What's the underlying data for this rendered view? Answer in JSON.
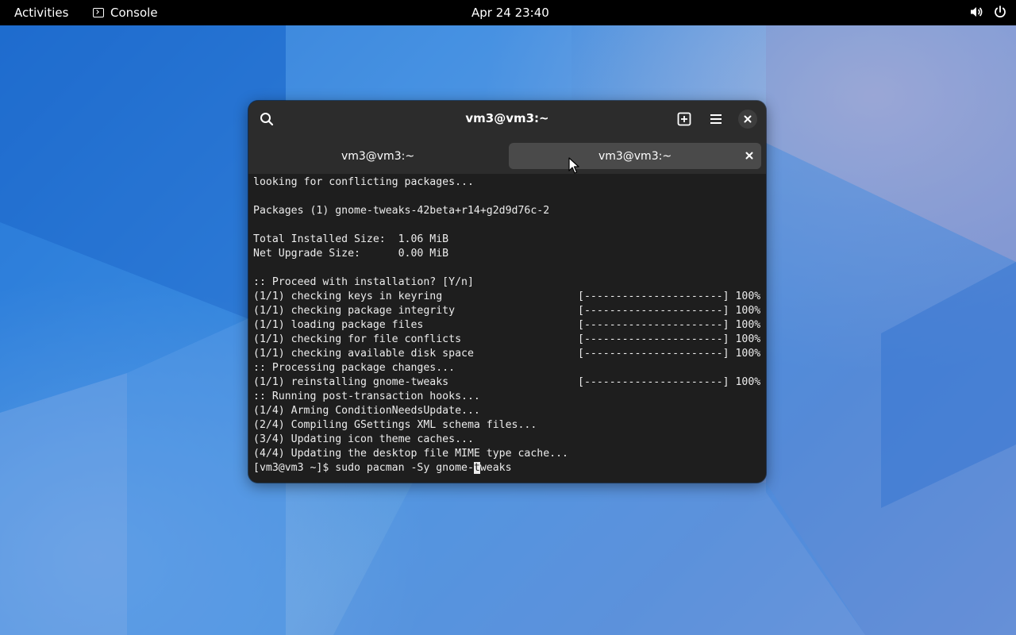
{
  "topbar": {
    "activities": "Activities",
    "app_name": "Console",
    "clock": "Apr 24  23:40",
    "icons": [
      "speaker-icon",
      "power-icon"
    ]
  },
  "window": {
    "title": "vm3@vm3:~",
    "icons": [
      "search-icon",
      "new-tab-icon",
      "menu-icon",
      "close-icon"
    ],
    "tabs": [
      {
        "label": "vm3@vm3:~",
        "active": false
      },
      {
        "label": "vm3@vm3:~",
        "active": true
      }
    ]
  },
  "terminal": {
    "lines": [
      {
        "text": "looking for conflicting packages...",
        "bar": ""
      },
      {
        "text": "",
        "bar": ""
      },
      {
        "text": "Packages (1) gnome-tweaks-42beta+r14+g2d9d76c-2",
        "bar": ""
      },
      {
        "text": "",
        "bar": ""
      },
      {
        "text": "Total Installed Size:  1.06 MiB",
        "bar": ""
      },
      {
        "text": "Net Upgrade Size:      0.00 MiB",
        "bar": ""
      },
      {
        "text": "",
        "bar": ""
      },
      {
        "text": ":: Proceed with installation? [Y/n]",
        "bar": ""
      },
      {
        "text": "(1/1) checking keys in keyring",
        "bar": "[----------------------] 100%"
      },
      {
        "text": "(1/1) checking package integrity",
        "bar": "[----------------------] 100%"
      },
      {
        "text": "(1/1) loading package files",
        "bar": "[----------------------] 100%"
      },
      {
        "text": "(1/1) checking for file conflicts",
        "bar": "[----------------------] 100%"
      },
      {
        "text": "(1/1) checking available disk space",
        "bar": "[----------------------] 100%"
      },
      {
        "text": ":: Processing package changes...",
        "bar": ""
      },
      {
        "text": "(1/1) reinstalling gnome-tweaks",
        "bar": "[----------------------] 100%"
      },
      {
        "text": ":: Running post-transaction hooks...",
        "bar": ""
      },
      {
        "text": "(1/4) Arming ConditionNeedsUpdate...",
        "bar": ""
      },
      {
        "text": "(2/4) Compiling GSettings XML schema files...",
        "bar": ""
      },
      {
        "text": "(3/4) Updating icon theme caches...",
        "bar": ""
      },
      {
        "text": "(4/4) Updating the desktop file MIME type cache...",
        "bar": ""
      }
    ],
    "prompt": {
      "before_cursor": "[vm3@vm3 ~]$ sudo pacman -Sy gnome-",
      "cursor_char": "t",
      "after_cursor": "weaks"
    }
  },
  "colors": {
    "topbar_bg": "#000000",
    "window_header": "#2c2c2c",
    "active_tab": "#4a4a4a",
    "terminal_bg": "#1e1e1e",
    "terminal_fg": "#ececec"
  }
}
